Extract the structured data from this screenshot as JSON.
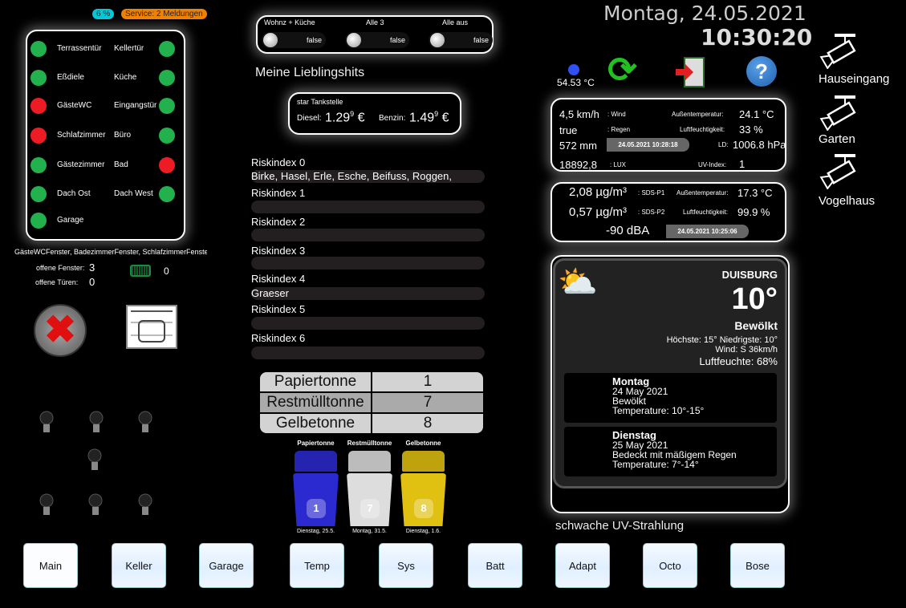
{
  "badges": {
    "battery_pct": "6 %",
    "service": "Service: 2 Meldungen"
  },
  "doors": {
    "left": [
      {
        "label": "Terrassentür",
        "status": "closed"
      },
      {
        "label": "Eßdiele",
        "status": "closed"
      },
      {
        "label": "GästeWC",
        "status": "open"
      },
      {
        "label": "Schlafzimmer",
        "status": "open"
      },
      {
        "label": "Gästezimmer",
        "status": "closed"
      },
      {
        "label": "Dach Ost",
        "status": "closed"
      },
      {
        "label": "Garage",
        "status": "closed"
      }
    ],
    "right": [
      {
        "label": "Kellertür",
        "status": "closed"
      },
      {
        "label": "Küche",
        "status": "closed"
      },
      {
        "label": "Eingangstür",
        "status": "closed"
      },
      {
        "label": "Büro",
        "status": "closed"
      },
      {
        "label": "Bad",
        "status": "open"
      },
      {
        "label": "Dach West",
        "status": "closed"
      }
    ]
  },
  "colors": {
    "closed": "#22b14c",
    "open": "#ed1c24"
  },
  "open_windows_list": "GästeWCFenster, BadezimmerFenster, SchlafzimmerFenster",
  "open_windows_label": "offene Fenster:",
  "open_windows": "3",
  "open_doors_label": "offene Türen:",
  "open_doors": "0",
  "battery_count": "0",
  "toggles": [
    {
      "label": "Wohnz + Küche",
      "value": "false"
    },
    {
      "label": "Alle 3",
      "value": "false"
    },
    {
      "label": "Alle aus",
      "value": "false"
    }
  ],
  "favorites_title": "Meine Lieblingshits",
  "fuel": {
    "station": "star Tankstelle",
    "diesel_label": "Diesel:",
    "diesel": "1.29",
    "diesel_sup": "9",
    "benzin_label": "Benzin:",
    "benzin": "1.49",
    "benzin_sup": "9",
    "currency": "€"
  },
  "pollen": [
    {
      "label": "Riskindex 0",
      "value": "Birke, Hasel, Erle, Esche, Beifuss, Roggen,"
    },
    {
      "label": "Riskindex 1",
      "value": ""
    },
    {
      "label": "Riskindex 2",
      "value": ""
    },
    {
      "label": "Riskindex 3",
      "value": ""
    },
    {
      "label": "Riskindex 4",
      "value": "Graeser"
    },
    {
      "label": "Riskindex 5",
      "value": ""
    },
    {
      "label": "Riskindex 6",
      "value": ""
    }
  ],
  "waste_table": [
    {
      "name": "Papiertonne",
      "days": "1"
    },
    {
      "name": "Restmülltonne",
      "days": "7"
    },
    {
      "name": "Gelbetonne",
      "days": "8"
    }
  ],
  "bins": [
    {
      "name": "Papiertonne",
      "days": "1",
      "date": "Dienstag, 25.5.",
      "color": "#2a2ad0"
    },
    {
      "name": "Restmülltonne",
      "days": "7",
      "date": "Montag, 31.5.",
      "color": "#dddddd"
    },
    {
      "name": "Gelbetonne",
      "days": "8",
      "date": "Dienstag, 1.6.",
      "color": "#e0c010"
    }
  ],
  "datetime": {
    "date": "Montag, 24.05.2021",
    "time": "10:30:20"
  },
  "cpu_temp": "54.53 °C",
  "weather_station": {
    "wind": "4,5 km/h",
    "wind_label": ": Wind",
    "rain": "true",
    "rain_label": ": Regen",
    "rain_mm": "572 mm",
    "timestamp": "24.05.2021 10:28:18",
    "lux": "18892,8",
    "lux_label": ": LUX",
    "temp_label": "Außentemperatur:",
    "temp": "24.1 °C",
    "hum_label": "Luftfeuchtigkeit:",
    "hum": "33 %",
    "ld_label": "LD:",
    "ld": "1006.8 hPa",
    "uv_label": "UV-Index:",
    "uv": "1"
  },
  "air": {
    "p1": "2,08 µg/m³",
    "p1_label": ": SDS-P1",
    "p2": "0,57 µg/m³",
    "p2_label": ": SDS-P2",
    "noise": "-90 dBA",
    "timestamp": "24.05.2021 10:25:06",
    "temp_label": "Außentemperatur:",
    "temp": "17.3 °C",
    "hum_label": "Luftfeuchtigkeit:",
    "hum": "99.9 %"
  },
  "weather": {
    "city": "DUISBURG",
    "temp": "10°",
    "condition": "Bewölkt",
    "hilo": "Höchste: 15° Niedrigste: 10°",
    "wind": "Wind: S 36km/h",
    "humidity": "Luftfeuchte: 68%",
    "forecast": [
      {
        "day": "Montag",
        "date": "24 May 2021",
        "cond": "Bewölkt",
        "temp": "Temperature: 10°-15°"
      },
      {
        "day": "Dienstag",
        "date": "25 May 2021",
        "cond": "Bedeckt mit mäßigem Regen",
        "temp": "Temperature: 7°-14°"
      }
    ]
  },
  "uv_text": "schwache UV-Strahlung",
  "cameras": [
    "Hauseingang",
    "Garten",
    "Vogelhaus"
  ],
  "nav": [
    "Main",
    "Keller",
    "Garage",
    "Temp",
    "Sys",
    "Batt",
    "Adapt",
    "Octo",
    "Bose"
  ]
}
